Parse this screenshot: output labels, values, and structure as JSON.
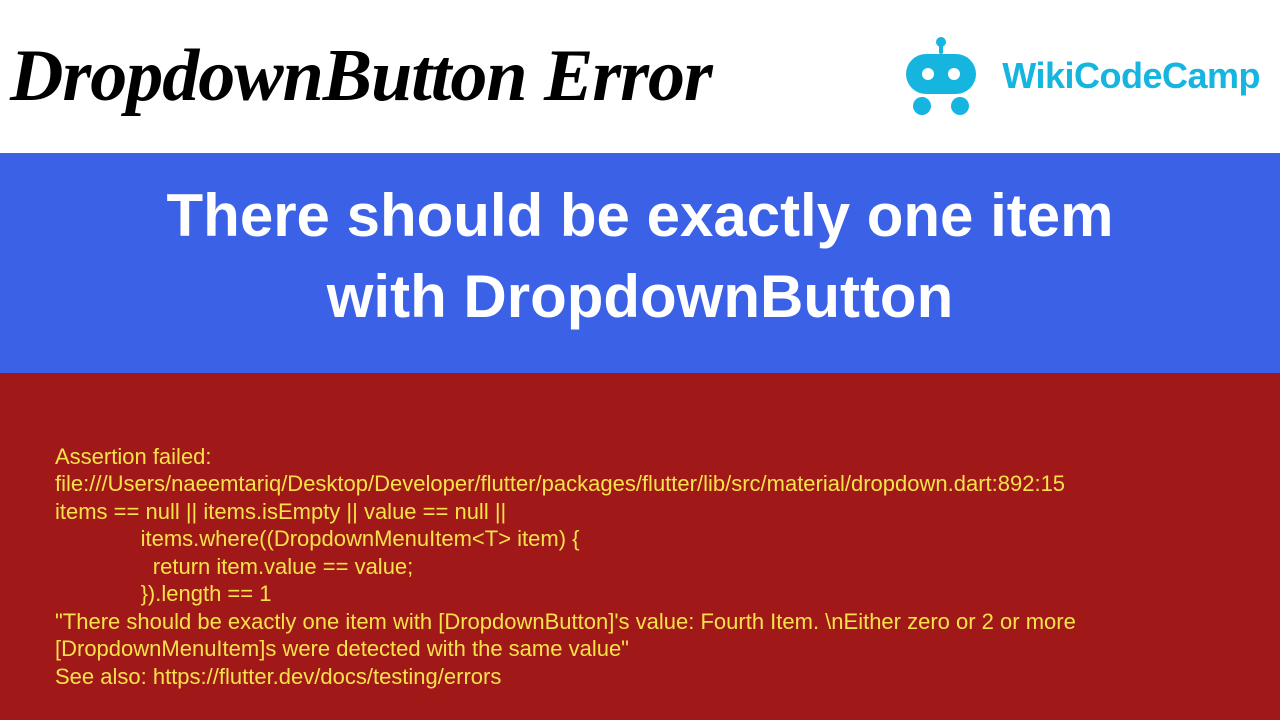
{
  "header": {
    "title": "DropdownButton Error",
    "brand_name": "WikiCodeCamp"
  },
  "banner": {
    "line1": "There should be exactly one item",
    "line2": "with DropdownButton"
  },
  "error": {
    "text": "Assertion failed: file:///Users/naeemtariq/Desktop/Developer/flutter/packages/flutter/lib/src/material/dropdown.dart:892:15\nitems == null || items.isEmpty || value == null ||\n              items.where((DropdownMenuItem<T> item) {\n                return item.value == value;\n              }).length == 1\n\"There should be exactly one item with [DropdownButton]'s value: Fourth Item. \\nEither zero or 2 or more [DropdownMenuItem]s were detected with the same value\"\nSee also: https://flutter.dev/docs/testing/errors"
  },
  "colors": {
    "brand": "#16b5e0",
    "banner_bg": "#3b62e6",
    "error_bg": "#a11818",
    "error_fg": "#f7e24a"
  }
}
